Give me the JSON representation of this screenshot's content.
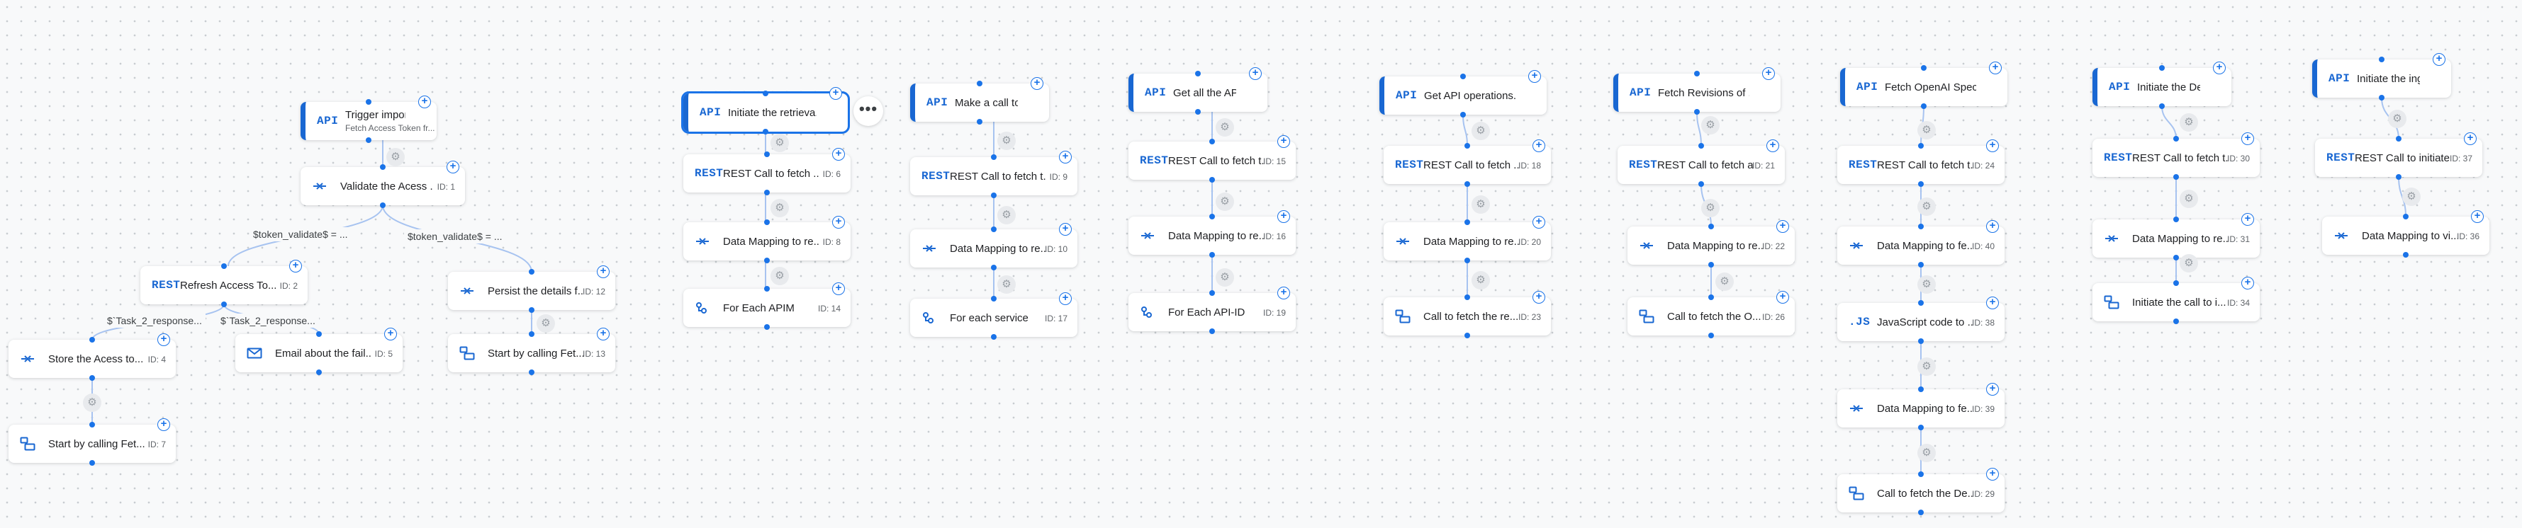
{
  "canvas": {
    "accent": "#1a73e8",
    "edge_color": "#a7c3f0",
    "background": "#f8f9fa"
  },
  "nodes": {
    "trigger_import": {
      "icon": "API",
      "title": "Trigger import of d...",
      "subtitle": "Fetch Access Token fr..."
    },
    "validate_access": {
      "icon": "data-mapping-icon",
      "title": "Validate the Acess ...",
      "id": "ID: 1"
    },
    "refresh_access": {
      "icon": "REST",
      "title": "Refresh Access To...",
      "id": "ID: 2"
    },
    "persist_details": {
      "icon": "data-mapping-icon",
      "title": "Persist the details f...",
      "id": "ID: 12"
    },
    "store_access": {
      "icon": "data-mapping-icon",
      "title": "Store the Acess to...",
      "id": "ID: 4"
    },
    "email_failure": {
      "icon": "mail-icon",
      "title": "Email about the fail...",
      "id": "ID: 5"
    },
    "start_by_calling_13": {
      "icon": "subflow-icon",
      "title": "Start by calling Fet...",
      "id": "ID: 13"
    },
    "start_by_calling_7": {
      "icon": "subflow-icon",
      "title": "Start by calling Fet...",
      "id": "ID: 7"
    },
    "c2_trigger": {
      "icon": "API",
      "title": "Initiate the retrieva..."
    },
    "c2_rest": {
      "icon": "REST",
      "title": "REST Call to fetch ...",
      "id": "ID: 6"
    },
    "c2_map": {
      "icon": "data-mapping-icon",
      "title": "Data Mapping to re...",
      "id": "ID: 8"
    },
    "c2_foreach": {
      "icon": "for-each-icon",
      "title": "For Each APIM",
      "id": "ID: 14"
    },
    "c3_trigger": {
      "icon": "API",
      "title": "Make a call to fetc..."
    },
    "c3_rest": {
      "icon": "REST",
      "title": "REST Call to fetch t...",
      "id": "ID: 9"
    },
    "c3_map": {
      "icon": "data-mapping-icon",
      "title": "Data Mapping to re...",
      "id": "ID: 10"
    },
    "c3_foreach": {
      "icon": "for-each-icon",
      "title": "For each service",
      "id": "ID: 17"
    },
    "c4_trigger": {
      "icon": "API",
      "title": "Get all the APIs pre..."
    },
    "c4_rest": {
      "icon": "REST",
      "title": "REST Call to fetch t...",
      "id": "ID: 15"
    },
    "c4_map": {
      "icon": "data-mapping-icon",
      "title": "Data Mapping to re...",
      "id": "ID: 16"
    },
    "c4_foreach": {
      "icon": "for-each-icon",
      "title": "For Each API-ID",
      "id": "ID: 19"
    },
    "c5_trigger": {
      "icon": "API",
      "title": "Get API operations..."
    },
    "c5_rest": {
      "icon": "REST",
      "title": "REST Call to fetch ...",
      "id": "ID: 18"
    },
    "c5_map": {
      "icon": "data-mapping-icon",
      "title": "Data Mapping to re...",
      "id": "ID: 20"
    },
    "c5_call": {
      "icon": "subflow-icon",
      "title": "Call to fetch the re...",
      "id": "ID: 23"
    },
    "c6_trigger": {
      "icon": "API",
      "title": "Fetch Revisions of ..."
    },
    "c6_rest": {
      "icon": "REST",
      "title": "REST Call to fetch a...",
      "id": "ID: 21"
    },
    "c6_map": {
      "icon": "data-mapping-icon",
      "title": "Data Mapping to re...",
      "id": "ID: 22"
    },
    "c6_call": {
      "icon": "subflow-icon",
      "title": "Call to fetch the O...",
      "id": "ID: 26"
    },
    "c7_trigger": {
      "icon": "API",
      "title": "Fetch OpenAI Specs"
    },
    "c7_rest": {
      "icon": "REST",
      "title": "REST Call to fetch t...",
      "id": "ID: 24"
    },
    "c7_map1": {
      "icon": "data-mapping-icon",
      "title": "Data Mapping to fe...",
      "id": "ID: 40"
    },
    "c7_js": {
      "icon": ".JS",
      "title": "JavaScript code to ...",
      "id": "ID: 38"
    },
    "c7_map2": {
      "icon": "data-mapping-icon",
      "title": "Data Mapping to fe...",
      "id": "ID: 39"
    },
    "c7_call": {
      "icon": "subflow-icon",
      "title": "Call to fetch the De...",
      "id": "ID: 29"
    },
    "c8_trigger": {
      "icon": "API",
      "title": "Initiate the Deploy..."
    },
    "c8_rest": {
      "icon": "REST",
      "title": "REST Call to fetch t...",
      "id": "ID: 30"
    },
    "c8_map": {
      "icon": "data-mapping-icon",
      "title": "Data Mapping to re...",
      "id": "ID: 31"
    },
    "c8_call": {
      "icon": "subflow-icon",
      "title": "Initiate the call to i...",
      "id": "ID: 34"
    },
    "c9_trigger": {
      "icon": "API",
      "title": "Initiate the ingestio..."
    },
    "c9_rest": {
      "icon": "REST",
      "title": "REST Call to initiate...",
      "id": "ID: 37"
    },
    "c9_map": {
      "icon": "data-mapping-icon",
      "title": "Data Mapping to vi...",
      "id": "ID: 36"
    }
  },
  "edge_labels": {
    "token_left": "$token_validate$ = ...",
    "token_right": "$token_validate$ = ...",
    "task2_left": "$`Task_2_response...",
    "task2_right": "$`Task_2_response..."
  },
  "more_menu": "•••"
}
